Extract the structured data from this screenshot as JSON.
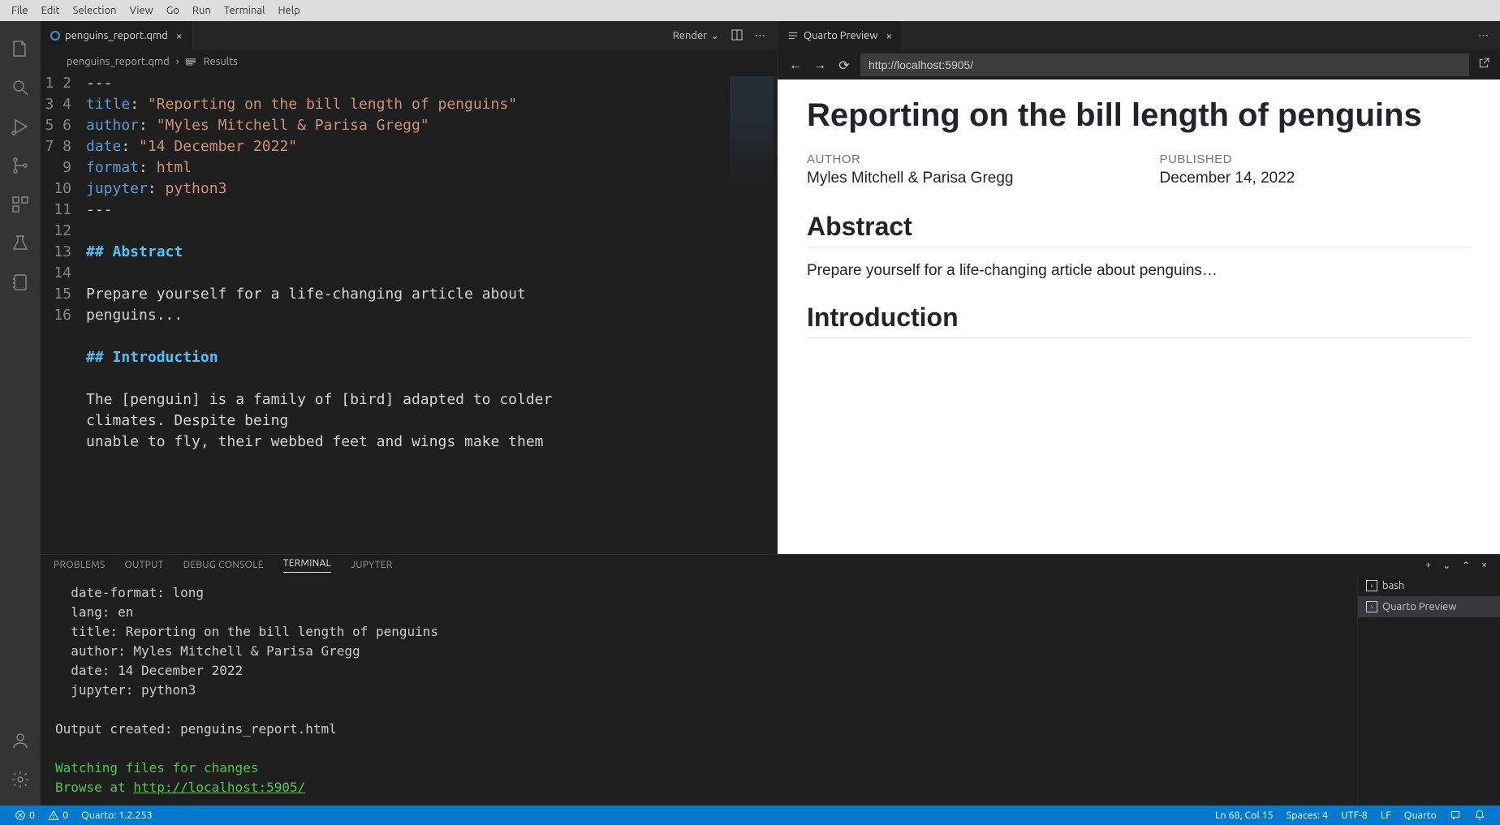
{
  "menubar": [
    "File",
    "Edit",
    "Selection",
    "View",
    "Go",
    "Run",
    "Terminal",
    "Help"
  ],
  "editor": {
    "tab_name": "penguins_report.qmd",
    "render_label": "Render",
    "breadcrumb_file": "penguins_report.qmd",
    "breadcrumb_symbol": "Results",
    "lines": {
      "l1": "---",
      "l2k": "title",
      "l2v": "\"Reporting on the bill length of penguins\"",
      "l3k": "author",
      "l3v": "\"Myles Mitchell & Parisa Gregg\"",
      "l4k": "date",
      "l4v": "\"14 December 2022\"",
      "l5k": "format",
      "l5v": "html",
      "l6k": "jupyter",
      "l6v": "python3",
      "l7": "---",
      "l9": "## Abstract",
      "l11a": "Prepare yourself for a life-changing article about ",
      "l11b": "penguins...",
      "l13": "## Introduction",
      "l15a": "The [penguin] is a family of [bird] adapted to colder ",
      "l15b": "climates. Despite being",
      "l16": "unable to fly, their webbed feet and wings make them "
    }
  },
  "preview": {
    "tab_name": "Quarto Preview",
    "url": "http://localhost:5905/",
    "title": "Reporting on the bill length of penguins",
    "author_label": "AUTHOR",
    "author_val": "Myles Mitchell & Parisa Gregg",
    "published_label": "PUBLISHED",
    "published_val": "December 14, 2022",
    "h_abstract": "Abstract",
    "p_abstract": "Prepare yourself for a life-changing article about penguins…",
    "h_intro": "Introduction"
  },
  "panel": {
    "tabs": [
      "PROBLEMS",
      "OUTPUT",
      "DEBUG CONSOLE",
      "TERMINAL",
      "JUPYTER"
    ],
    "terminal_lines": {
      "t1": "  date-format: long",
      "t2": "  lang: en",
      "t3": "  title: Reporting on the bill length of penguins",
      "t4": "  author: Myles Mitchell & Parisa Gregg",
      "t5": "  date: 14 December 2022",
      "t6": "  jupyter: python3",
      "t7": "",
      "t8": "Output created: penguins_report.html",
      "t9": "",
      "t10a": "Watching files for changes",
      "t11a": "Browse at ",
      "t11b": "http://localhost:5905/"
    },
    "terminals": [
      "bash",
      "Quarto Preview"
    ]
  },
  "status": {
    "errors": "0",
    "warnings": "0",
    "quarto_ver": "Quarto: 1.2.253",
    "lncol": "Ln 68, Col 15",
    "spaces": "Spaces: 4",
    "encoding": "UTF-8",
    "eol": "LF",
    "lang": "Quarto"
  }
}
